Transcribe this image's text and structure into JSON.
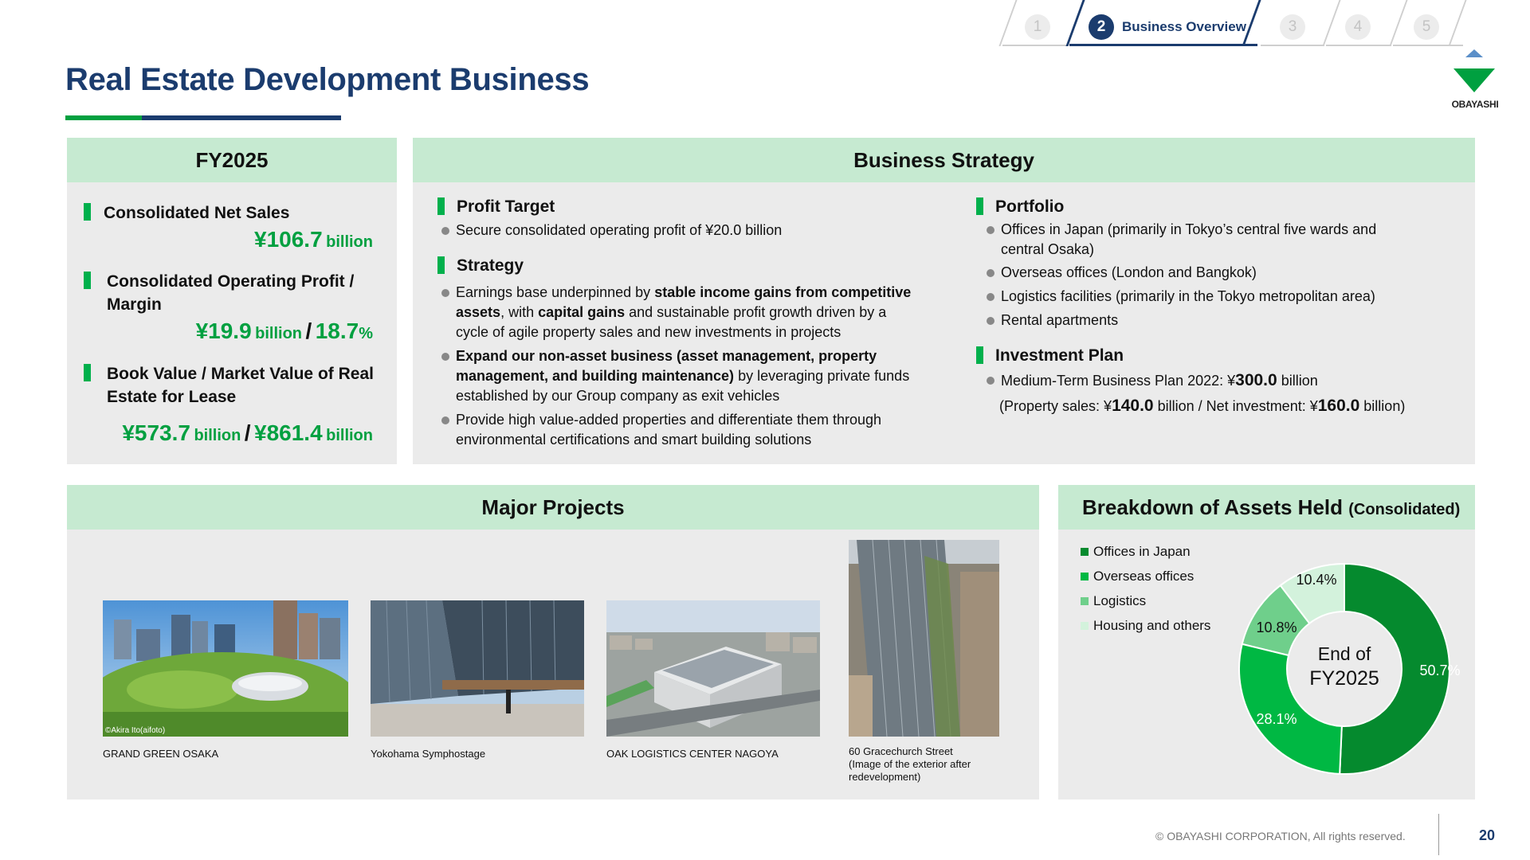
{
  "nav": {
    "tabs": [
      {
        "number": "1",
        "label": ""
      },
      {
        "number": "2",
        "label": "Business Overview"
      },
      {
        "number": "3",
        "label": ""
      },
      {
        "number": "4",
        "label": ""
      },
      {
        "number": "5",
        "label": ""
      }
    ],
    "active_tab": 2
  },
  "title": "Real Estate Development Business",
  "logo": {
    "text": "OBAYASHI",
    "color": "#00a040"
  },
  "fy2025": {
    "heading": "FY2025",
    "net_sales": {
      "label": "Consolidated Net Sales",
      "value": "¥106.7",
      "unit": "billion"
    },
    "operating_profit": {
      "label_line1": "Consolidated Operating Profit /",
      "label_line2": "Margin",
      "value": "¥19.9",
      "unit": "billion",
      "sep": "/",
      "margin": "18.7",
      "margin_unit": "%"
    },
    "book_value": {
      "label_line1": "Book Value / Market Value of Real",
      "label_line2": "Estate for Lease",
      "value1": "¥573.7",
      "unit1": "billion",
      "sep": "/",
      "value2": "¥861.4",
      "unit2": "billion"
    }
  },
  "strategy": {
    "heading": "Business Strategy",
    "profit_target": {
      "title": "Profit Target",
      "bullet": "Secure consolidated operating profit of ¥20.0 billion"
    },
    "strategy": {
      "title": "Strategy",
      "b1_a": "Earnings base underpinned by ",
      "b1_b": "stable income gains from competitive",
      "b1_c": "assets",
      "b1_d": ", with ",
      "b1_e": "capital gains",
      "b1_f": " and sustainable profit growth driven by a",
      "b1_g": "cycle of agile property sales and new investments in projects",
      "b2_a": "Expand our non-asset business (asset management, property",
      "b2_b": "management, and building maintenance)",
      "b2_c": " by leveraging private funds",
      "b2_d": "established by our Group company as exit vehicles",
      "b3_a": "Provide high value-added properties and differentiate them through",
      "b3_b": "environmental certifications and smart building solutions"
    },
    "portfolio": {
      "title": "Portfolio",
      "b1_a": "Offices in Japan (primarily in Tokyo’s central five wards and",
      "b1_b": "central Osaka)",
      "b2": "Overseas offices (London and Bangkok)",
      "b3": "Logistics facilities (primarily in the Tokyo metropolitan area)",
      "b4": "Rental apartments"
    },
    "investment": {
      "title": "Investment Plan",
      "b1_a": "Medium-Term Business Plan 2022: ¥",
      "b1_num": "300.0",
      "b1_b": " billion",
      "l2_a": "(Property sales: ¥",
      "l2_num1": "140.0",
      "l2_b": " billion / Net investment: ¥",
      "l2_num2": "160.0",
      "l2_c": " billion)"
    }
  },
  "projects": {
    "heading": "Major Projects",
    "items": [
      {
        "caption": "GRAND GREEN OSAKA",
        "credit": "©Akira Ito(aifoto)"
      },
      {
        "caption": "Yokohama Symphostage",
        "credit": ""
      },
      {
        "caption": "OAK LOGISTICS CENTER NAGOYA",
        "credit": ""
      },
      {
        "caption_line1": "60 Gracechurch Street",
        "caption_line2": "(Image of the exterior after",
        "caption_line3": "redevelopment)"
      }
    ]
  },
  "assets": {
    "heading": "Breakdown of Assets Held",
    "heading_suffix": "(Consolidated)",
    "center_line1": "End of",
    "center_line2": "FY2025"
  },
  "chart_data": {
    "type": "pie",
    "title": "Breakdown of Assets Held (Consolidated)",
    "categories": [
      "Offices in Japan",
      "Overseas offices",
      "Logistics",
      "Housing and others"
    ],
    "values": [
      50.7,
      28.1,
      10.8,
      10.4
    ],
    "labels": [
      "50.7%",
      "28.1%",
      "10.8%",
      "10.4%"
    ],
    "colors": [
      "#058a2e",
      "#00b843",
      "#6fcf8b",
      "#d3f2dc"
    ],
    "donut": true,
    "legend": "left"
  },
  "footer": {
    "copyright": "© OBAYASHI CORPORATION, All rights reserved.",
    "page": "20"
  }
}
